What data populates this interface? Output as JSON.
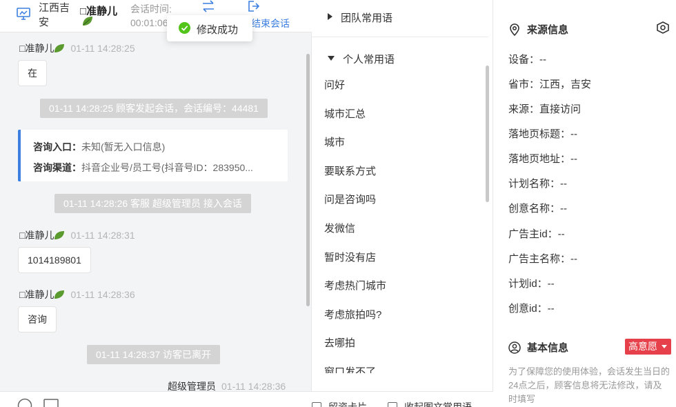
{
  "header": {
    "region": "江西吉安",
    "visitor_name": "准静儿",
    "session_time_label": "会话时间:",
    "session_time_value": "00:01:06",
    "end_session_label": "结束会话"
  },
  "toast": {
    "text": "修改成功"
  },
  "messages": {
    "msg1": {
      "sender": "准静儿",
      "time": "01-11 14:28:25",
      "text": "在"
    },
    "sys1": "01-11 14:28:25 顾客发起会话，会话编号：44481",
    "info": {
      "entry_label": "咨询入口：",
      "entry_value": "未知(暂无入口信息)",
      "channel_label": "咨询渠道：",
      "channel_value": "抖音企业号/员工号(抖音号ID：283950..."
    },
    "sys2": "01-11 14:28:26 客服 超级管理员 接入会话",
    "msg2": {
      "sender": "准静儿",
      "time": "01-11 14:28:31",
      "text": "1014189801"
    },
    "msg3": {
      "sender": "准静儿",
      "time": "01-11 14:28:36",
      "text": "咨询"
    },
    "sys3": "01-11 14:28:37 访客已离开",
    "agent": {
      "sender": "超级管理员",
      "time": "01-11 14:28:36"
    }
  },
  "phrases": {
    "team_title": "团队常用语",
    "personal_title": "个人常用语",
    "items": [
      "问好",
      "城市汇总",
      "城市",
      "要联系方式",
      "问是咨询吗",
      "发微信",
      "暂时没有店",
      "考虑热门城市",
      "考虑旅拍吗?",
      "去哪拍",
      "窗口发不了"
    ],
    "footer_left": "留资卡片",
    "footer_right": "收起图文常用语"
  },
  "source": {
    "title": "来源信息",
    "rows": [
      "设备：--",
      "省市：江西，吉安",
      "来源：直接访问",
      "落地页标题：--",
      "落地页地址：--",
      "计划名称：--",
      "创意名称：--",
      "广告主id：--",
      "广告主名称：--",
      "计划id：--",
      "创意id：--"
    ]
  },
  "basic": {
    "title": "基本信息",
    "badge": "高意愿",
    "notice": "为了保障您的使用体验，会话发生当日的24点之后，顾客信息将无法修改，请及时填写"
  },
  "colors": {
    "accent": "#3c7fe0",
    "success": "#52c41a",
    "badge": "#e6404a",
    "system_msg": "#d4d4d4"
  }
}
